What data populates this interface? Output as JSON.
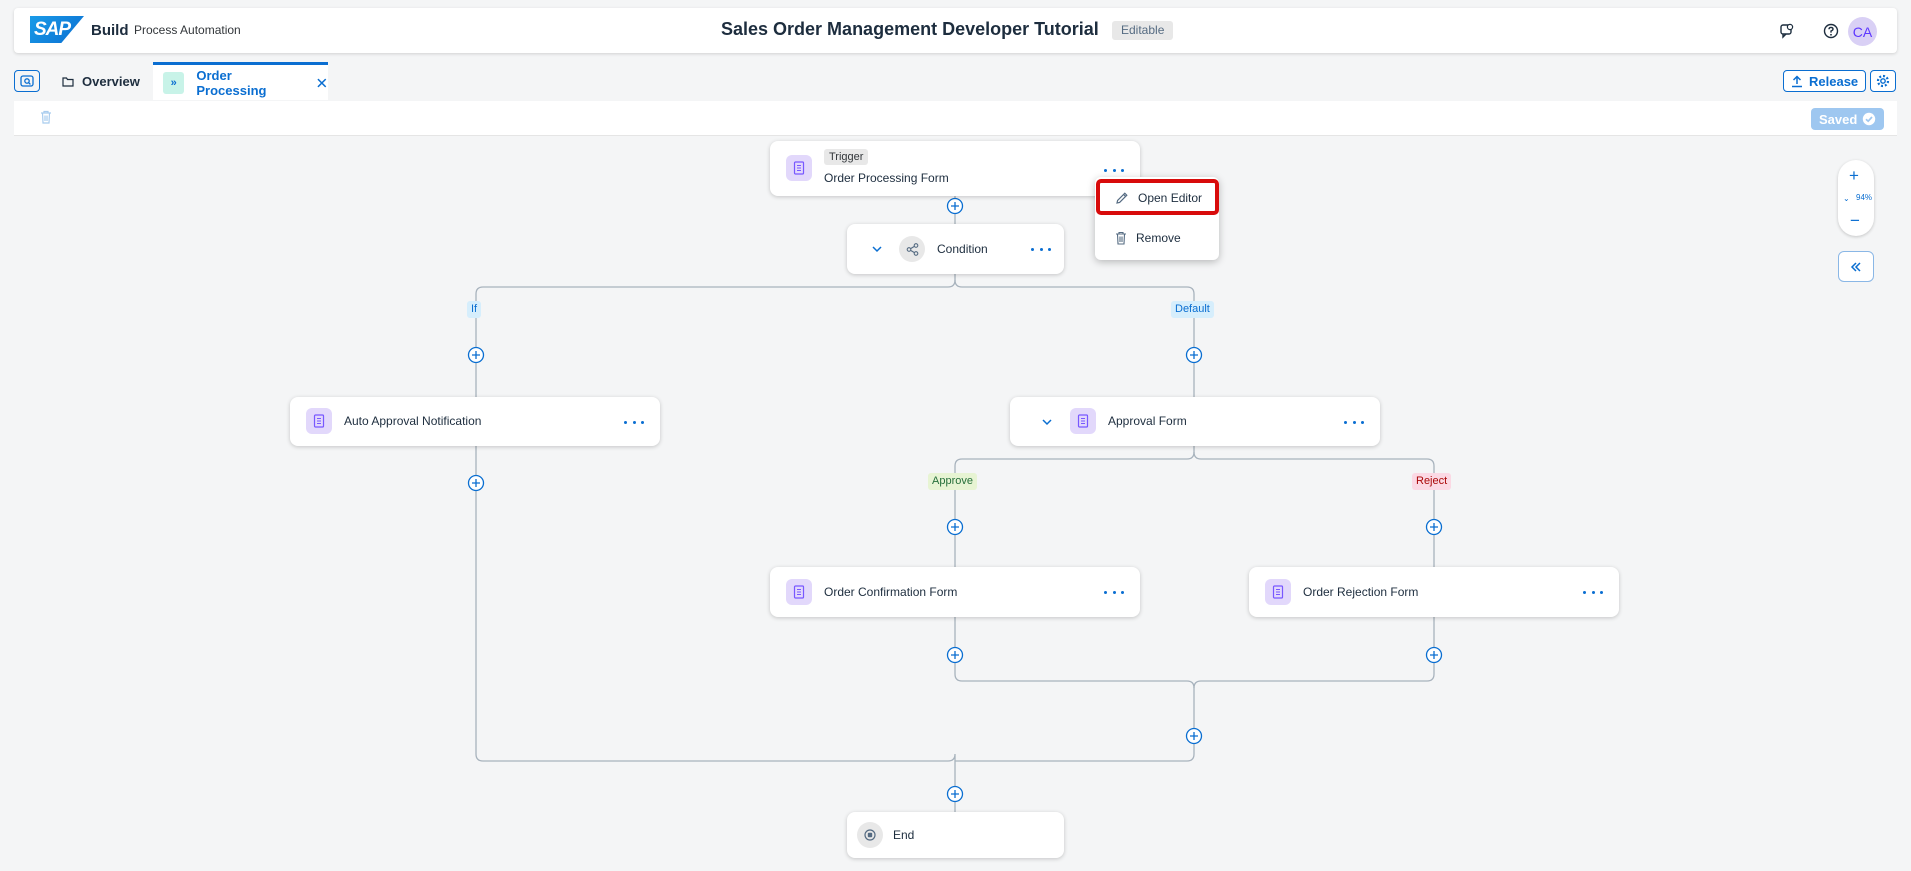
{
  "shell": {
    "logo_text": "SAP",
    "build": "Build",
    "product": "Process Automation",
    "title": "Sales Order Management Developer Tutorial",
    "status_badge": "Editable",
    "avatar_initials": "CA",
    "icons": [
      "feedback-icon",
      "help-icon"
    ]
  },
  "tabs": {
    "overview": "Overview",
    "active": "Order Processing",
    "active_badge": "»"
  },
  "actions": {
    "release": "Release",
    "saved": "Saved"
  },
  "flow": {
    "trigger_chip": "Trigger",
    "trigger_name": "Order Processing Form",
    "condition": "Condition",
    "branch_if": "If",
    "branch_default": "Default",
    "auto_approval": "Auto Approval Notification",
    "approval_form": "Approval Form",
    "branch_approve": "Approve",
    "branch_reject": "Reject",
    "confirmation_form": "Order Confirmation Form",
    "rejection_form": "Order Rejection Form",
    "end": "End"
  },
  "context_menu": {
    "open_editor": "Open Editor",
    "remove": "Remove"
  },
  "zoom": {
    "level": "94%"
  },
  "colors": {
    "accent": "#0a6ed1",
    "highlight": "#d80b0b",
    "approve_bg": "#e7f4d3",
    "reject_bg": "#fbd9e4",
    "default_bg": "#d6eefc"
  }
}
